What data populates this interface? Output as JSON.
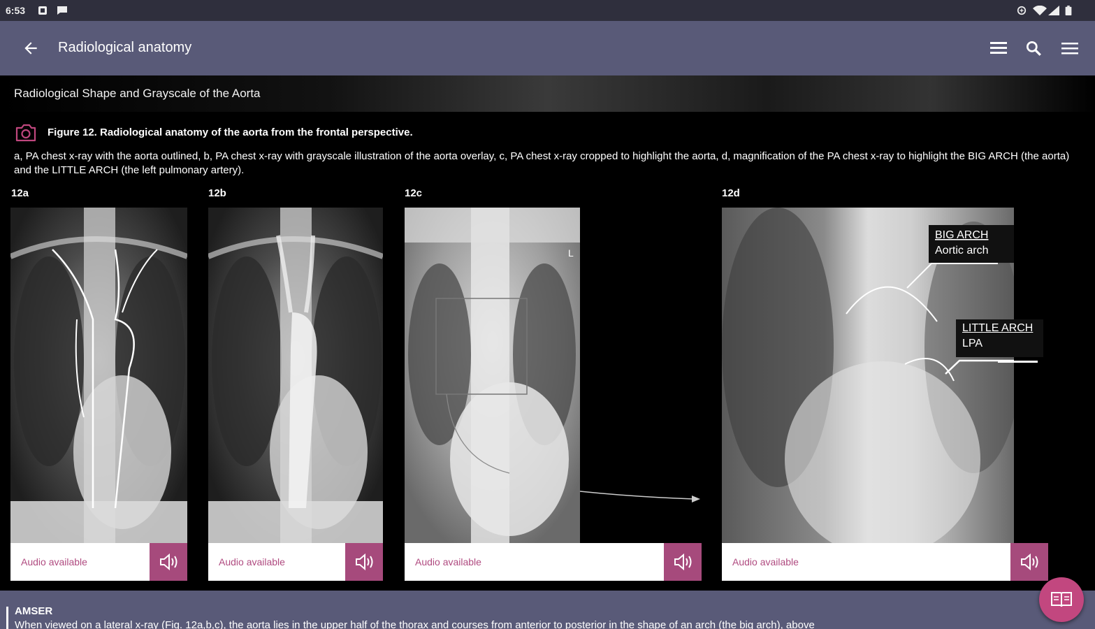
{
  "status": {
    "time": "6:53"
  },
  "appbar": {
    "title": "Radiological anatomy"
  },
  "section": {
    "title": "Radiological Shape and Grayscale of the Aorta"
  },
  "figure": {
    "title": "Figure 12. Radiological anatomy of the aorta from the frontal perspective.",
    "description": "a, PA chest x-ray with the aorta outlined, b, PA chest x-ray with grayscale illustration of the aorta overlay, c, PA chest x-ray cropped to highlight the aorta, d, magnification of the PA chest x-ray to highlight the BIG ARCH (the aorta) and the LITTLE ARCH (the left pulmonary artery).",
    "panels": [
      {
        "label": "12a",
        "audio": "Audio available"
      },
      {
        "label": "12b",
        "audio": "Audio available"
      },
      {
        "label": "12c",
        "audio": "Audio available"
      },
      {
        "label": "12d",
        "audio": "Audio available"
      }
    ],
    "annotations": {
      "big_arch_title": "BIG ARCH",
      "big_arch_sub": "Aortic arch",
      "little_arch_title": "LITTLE ARCH",
      "little_arch_sub": "LPA",
      "side_marker": "L"
    }
  },
  "bottom": {
    "label": "AMSER",
    "body": "When viewed on a lateral x-ray (Fig. 12a,b,c), the aorta lies in the upper half of the thorax and courses from anterior to posterior in the shape of an arch (the big arch), above"
  },
  "colors": {
    "accent": "#a64a7c",
    "appbar": "#595a78",
    "fab": "#c2477f"
  },
  "icons": [
    "back-arrow-icon",
    "list-icon",
    "search-icon",
    "menu-icon",
    "camera-icon",
    "speaker-icon",
    "book-icon"
  ]
}
